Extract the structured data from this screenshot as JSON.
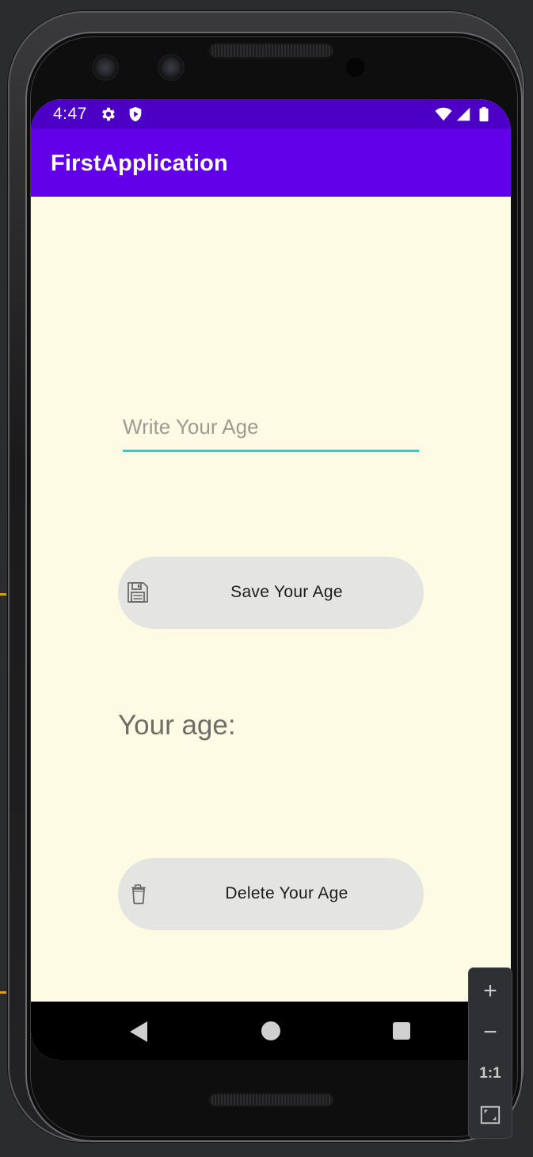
{
  "status_bar": {
    "time": "4:47",
    "icons": [
      "gear-icon",
      "shield-play-icon",
      "wifi-icon",
      "signal-icon",
      "battery-icon"
    ],
    "background": "#4c00c6"
  },
  "app_bar": {
    "title": "FirstApplication",
    "background": "#6200ea"
  },
  "content": {
    "background": "#fdfbe4",
    "age_input": {
      "value": "",
      "placeholder": "Write Your Age",
      "underline_color": "#1ad6cd"
    },
    "save_button": {
      "label": "Save Your Age",
      "icon": "floppy-disk-icon"
    },
    "age_label": "Your age:",
    "delete_button": {
      "label": "Delete Your Age",
      "icon": "trash-can-icon"
    }
  },
  "nav_bar": {
    "icons": [
      "back-triangle-icon",
      "home-circle-icon",
      "recents-square-icon"
    ]
  },
  "zoom_controls": {
    "zoom_in": "+",
    "zoom_out": "−",
    "actual_size": "1:1",
    "fit_icon": "fit-screen-icon"
  }
}
